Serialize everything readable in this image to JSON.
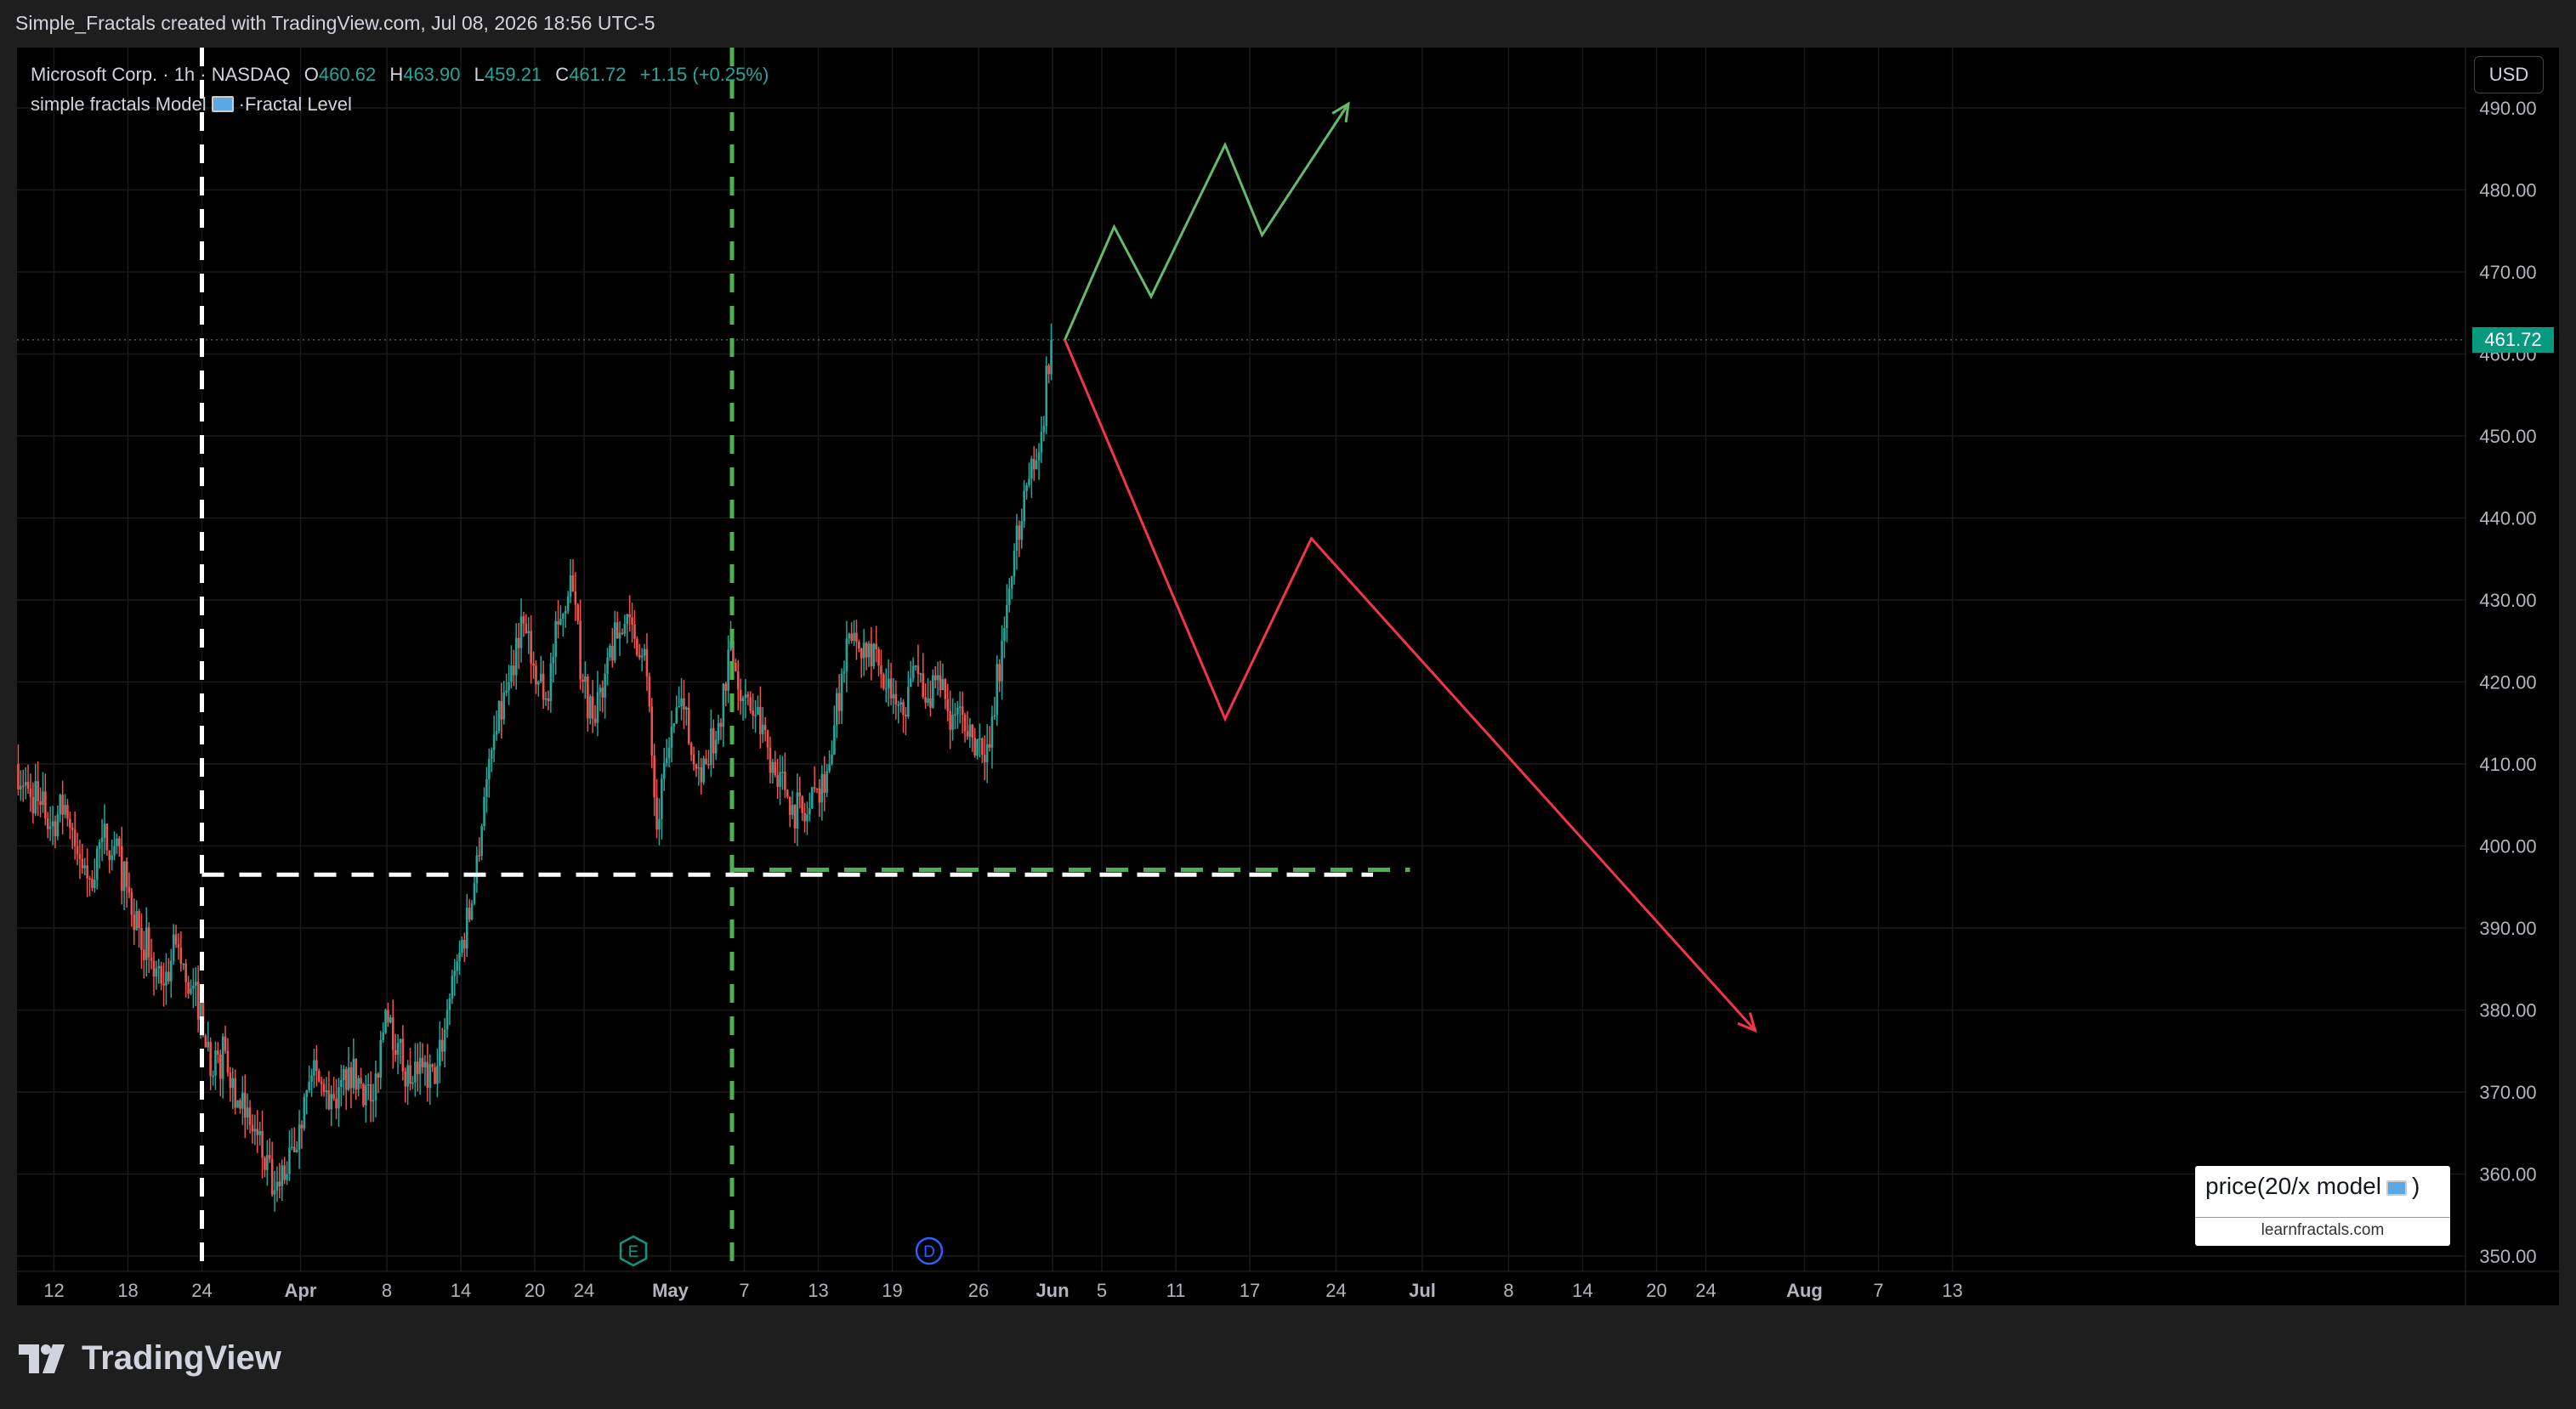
{
  "header": {
    "attribution": "Simple_Fractals created with TradingView.com, Jul 08, 2026 18:56 UTC-5"
  },
  "legend": {
    "symbol": "Microsoft Corp. · 1h · NASDAQ",
    "o_label": "O",
    "o_value": "460.62",
    "h_label": "H",
    "h_value": "463.90",
    "l_label": "L",
    "l_value": "459.21",
    "c_label": "C",
    "c_value": "461.72",
    "change": "+1.15 (+0.25%)",
    "indicator_prefix": "simple fractals Model",
    "indicator_suffix": "Fractal Level"
  },
  "currency": "USD",
  "last_price": "461.72",
  "model_box": {
    "title_prefix": "price(20/x model",
    "title_suffix": ")",
    "subtitle": "learnfractals.com"
  },
  "footer": {
    "brand": "TradingView"
  },
  "colors": {
    "up": "#26a69a",
    "down": "#ef5350",
    "bg": "#000000",
    "projection_up": "#66bb6a",
    "projection_down": "#f23645",
    "fractal_green": "#4caf50",
    "fractal_white": "#ffffff",
    "earnings_badge": "#089981",
    "dividend_badge": "#2962ff"
  },
  "chart_data": {
    "type": "candlestick",
    "interval": "1h",
    "ylim": [
      350,
      495
    ],
    "y_ticks": [
      "490.00",
      "480.00",
      "470.00",
      "460.00",
      "450.00",
      "440.00",
      "430.00",
      "420.00",
      "410.00",
      "400.00",
      "390.00",
      "380.00",
      "370.00",
      "360.00",
      "350.00"
    ],
    "y_tick_values": [
      490,
      480,
      470,
      460,
      450,
      440,
      430,
      420,
      410,
      400,
      390,
      380,
      370,
      360,
      350
    ],
    "x_ticks": [
      {
        "label": "12",
        "date": "2026-03-12"
      },
      {
        "label": "18",
        "date": "2026-03-18"
      },
      {
        "label": "24",
        "date": "2026-03-24"
      },
      {
        "label": "Apr",
        "date": "2026-04-01"
      },
      {
        "label": "8",
        "date": "2026-04-08"
      },
      {
        "label": "14",
        "date": "2026-04-14"
      },
      {
        "label": "20",
        "date": "2026-04-20"
      },
      {
        "label": "24",
        "date": "2026-04-24"
      },
      {
        "label": "May",
        "date": "2026-05-01"
      },
      {
        "label": "7",
        "date": "2026-05-07"
      },
      {
        "label": "13",
        "date": "2026-05-13"
      },
      {
        "label": "19",
        "date": "2026-05-19"
      },
      {
        "label": "26",
        "date": "2026-05-26"
      },
      {
        "label": "Jun",
        "date": "2026-06-01"
      },
      {
        "label": "5",
        "date": "2026-06-05"
      },
      {
        "label": "11",
        "date": "2026-06-11"
      },
      {
        "label": "17",
        "date": "2026-06-17"
      },
      {
        "label": "24",
        "date": "2026-06-24"
      },
      {
        "label": "Jul",
        "date": "2026-07-01"
      },
      {
        "label": "8",
        "date": "2026-07-08"
      },
      {
        "label": "14",
        "date": "2026-07-14"
      },
      {
        "label": "20",
        "date": "2026-07-20"
      },
      {
        "label": "24",
        "date": "2026-07-24"
      },
      {
        "label": "Aug",
        "date": "2026-08-01"
      },
      {
        "label": "7",
        "date": "2026-08-07"
      },
      {
        "label": "13",
        "date": "2026-08-13"
      }
    ],
    "price_path": [
      {
        "date": "2026-03-09",
        "price": 410
      },
      {
        "date": "2026-03-10",
        "price": 407
      },
      {
        "date": "2026-03-11",
        "price": 405
      },
      {
        "date": "2026-03-12",
        "price": 403
      },
      {
        "date": "2026-03-13",
        "price": 405
      },
      {
        "date": "2026-03-14",
        "price": 399
      },
      {
        "date": "2026-03-15",
        "price": 396
      },
      {
        "date": "2026-03-16",
        "price": 401
      },
      {
        "date": "2026-03-17",
        "price": 400
      },
      {
        "date": "2026-03-18",
        "price": 395
      },
      {
        "date": "2026-03-19",
        "price": 390
      },
      {
        "date": "2026-03-20",
        "price": 386
      },
      {
        "date": "2026-03-21",
        "price": 383
      },
      {
        "date": "2026-03-22",
        "price": 388
      },
      {
        "date": "2026-03-23",
        "price": 382
      },
      {
        "date": "2026-03-24",
        "price": 381
      },
      {
        "date": "2026-03-25",
        "price": 372
      },
      {
        "date": "2026-03-26",
        "price": 375
      },
      {
        "date": "2026-03-27",
        "price": 369
      },
      {
        "date": "2026-03-28",
        "price": 366
      },
      {
        "date": "2026-03-29",
        "price": 362
      },
      {
        "date": "2026-03-30",
        "price": 358
      },
      {
        "date": "2026-03-31",
        "price": 360
      },
      {
        "date": "2026-04-01",
        "price": 366
      },
      {
        "date": "2026-04-02",
        "price": 372
      },
      {
        "date": "2026-04-03",
        "price": 370
      },
      {
        "date": "2026-04-04",
        "price": 368
      },
      {
        "date": "2026-04-05",
        "price": 373
      },
      {
        "date": "2026-04-06",
        "price": 371
      },
      {
        "date": "2026-04-07",
        "price": 369
      },
      {
        "date": "2026-04-08",
        "price": 380
      },
      {
        "date": "2026-04-09",
        "price": 376
      },
      {
        "date": "2026-04-10",
        "price": 371
      },
      {
        "date": "2026-04-11",
        "price": 373
      },
      {
        "date": "2026-04-12",
        "price": 371
      },
      {
        "date": "2026-04-13",
        "price": 380
      },
      {
        "date": "2026-04-14",
        "price": 387
      },
      {
        "date": "2026-04-15",
        "price": 393
      },
      {
        "date": "2026-04-16",
        "price": 406
      },
      {
        "date": "2026-04-17",
        "price": 414
      },
      {
        "date": "2026-04-18",
        "price": 420
      },
      {
        "date": "2026-04-19",
        "price": 428
      },
      {
        "date": "2026-04-20",
        "price": 422
      },
      {
        "date": "2026-04-21",
        "price": 418
      },
      {
        "date": "2026-04-22",
        "price": 427
      },
      {
        "date": "2026-04-23",
        "price": 433
      },
      {
        "date": "2026-04-24",
        "price": 420
      },
      {
        "date": "2026-04-25",
        "price": 415
      },
      {
        "date": "2026-04-26",
        "price": 423
      },
      {
        "date": "2026-04-27",
        "price": 426
      },
      {
        "date": "2026-04-28",
        "price": 427
      },
      {
        "date": "2026-04-29",
        "price": 424
      },
      {
        "date": "2026-04-30",
        "price": 402
      },
      {
        "date": "2026-05-01",
        "price": 412
      },
      {
        "date": "2026-05-02",
        "price": 418
      },
      {
        "date": "2026-05-03",
        "price": 410
      },
      {
        "date": "2026-05-04",
        "price": 410
      },
      {
        "date": "2026-05-05",
        "price": 415
      },
      {
        "date": "2026-05-06",
        "price": 425
      },
      {
        "date": "2026-05-07",
        "price": 418
      },
      {
        "date": "2026-05-08",
        "price": 416
      },
      {
        "date": "2026-05-09",
        "price": 412
      },
      {
        "date": "2026-05-10",
        "price": 409
      },
      {
        "date": "2026-05-11",
        "price": 405
      },
      {
        "date": "2026-05-12",
        "price": 403
      },
      {
        "date": "2026-05-13",
        "price": 407
      },
      {
        "date": "2026-05-14",
        "price": 410
      },
      {
        "date": "2026-05-15",
        "price": 421
      },
      {
        "date": "2026-05-16",
        "price": 426
      },
      {
        "date": "2026-05-17",
        "price": 423
      },
      {
        "date": "2026-05-18",
        "price": 422
      },
      {
        "date": "2026-05-19",
        "price": 418
      },
      {
        "date": "2026-05-20",
        "price": 416
      },
      {
        "date": "2026-05-21",
        "price": 422
      },
      {
        "date": "2026-05-22",
        "price": 418
      },
      {
        "date": "2026-05-23",
        "price": 419
      },
      {
        "date": "2026-05-24",
        "price": 416
      },
      {
        "date": "2026-05-25",
        "price": 414
      },
      {
        "date": "2026-05-26",
        "price": 413
      },
      {
        "date": "2026-05-27",
        "price": 412
      },
      {
        "date": "2026-05-28",
        "price": 425
      },
      {
        "date": "2026-05-29",
        "price": 436
      },
      {
        "date": "2026-05-30",
        "price": 444
      },
      {
        "date": "2026-05-31",
        "price": 448
      },
      {
        "date": "2026-06-01",
        "price": 461.72
      }
    ],
    "current_price": 461.72,
    "fractal_levels": [
      {
        "color": "white",
        "price": 396.5,
        "from": "2026-03-24",
        "to": "2026-06-27"
      },
      {
        "color": "green",
        "price": 397.1,
        "from": "2026-05-06",
        "to": "2026-06-30"
      }
    ],
    "vertical_markers": [
      {
        "color": "white",
        "date": "2026-03-24"
      },
      {
        "color": "green",
        "date": "2026-05-06"
      }
    ],
    "event_badges": [
      {
        "label": "E",
        "date": "2026-04-28"
      },
      {
        "label": "D",
        "date": "2026-05-22"
      }
    ],
    "projections": [
      {
        "name": "up",
        "points": [
          [
            "2026-06-02",
            461.72
          ],
          [
            "2026-06-06",
            475.5
          ],
          [
            "2026-06-09",
            467
          ],
          [
            "2026-06-15",
            485.5
          ],
          [
            "2026-06-18",
            474.5
          ],
          [
            "2026-06-25",
            490.5
          ]
        ]
      },
      {
        "name": "down",
        "points": [
          [
            "2026-06-02",
            461.72
          ],
          [
            "2026-06-15",
            415.5
          ],
          [
            "2026-06-22",
            437.5
          ],
          [
            "2026-07-28",
            377.5
          ]
        ]
      }
    ]
  }
}
